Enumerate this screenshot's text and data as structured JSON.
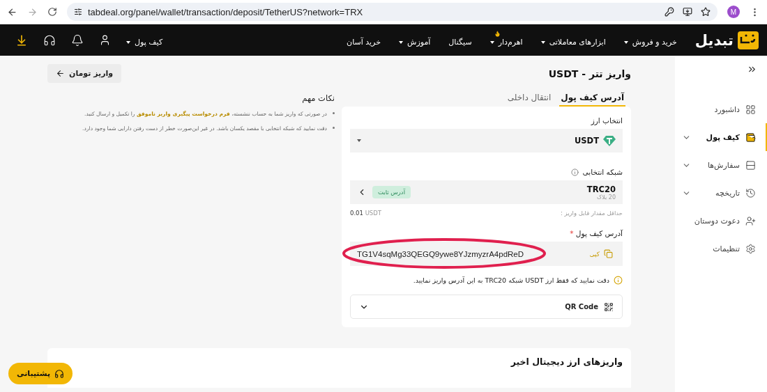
{
  "browser": {
    "url": "tabdeal.org/panel/wallet/transaction/deposit/TetherUS?network=TRX",
    "profile": "M"
  },
  "nav": {
    "logo": "تبدیل",
    "items": [
      {
        "label": "خرید و فروش",
        "dropdown": true,
        "hot": false
      },
      {
        "label": "ابزارهای معاملاتی",
        "dropdown": true,
        "hot": false
      },
      {
        "label": "اهرم‌دار",
        "dropdown": true,
        "hot": true
      },
      {
        "label": "سیگنال",
        "dropdown": false,
        "hot": false
      },
      {
        "label": "آموزش",
        "dropdown": true,
        "hot": false
      },
      {
        "label": "خرید آسان",
        "dropdown": false,
        "hot": false
      }
    ],
    "wallet": "کیف پول"
  },
  "sidebar": {
    "items": [
      {
        "kind": "dashboard",
        "label": "داشبورد",
        "selected": false,
        "expandable": false
      },
      {
        "kind": "wallet",
        "label": "کیف پول",
        "selected": true,
        "expandable": true
      },
      {
        "kind": "orders",
        "label": "سفارش‌ها",
        "selected": false,
        "expandable": true
      },
      {
        "kind": "history",
        "label": "تاریخچه",
        "selected": false,
        "expandable": true
      },
      {
        "kind": "invite",
        "label": "دعوت دوستان",
        "selected": false,
        "expandable": false
      },
      {
        "kind": "settings",
        "label": "تنظیمات",
        "selected": false,
        "expandable": false
      }
    ]
  },
  "page": {
    "title": "واریز تتر - USDT",
    "toman_button": "واریز تومان"
  },
  "tabs": [
    {
      "label": "آدرس کیف پول",
      "selected": true
    },
    {
      "label": "انتقال داخلی",
      "selected": false
    }
  ],
  "form": {
    "currency_label": "انتخاب ارز",
    "currency": "USDT",
    "network_label": "شبکه انتخابی",
    "network": "TRC20",
    "network_blocks": "20 بلاک",
    "network_badge": "آدرس ثابت",
    "min_label": "حداقل مقدار قابل واریز :",
    "min_amount": "0.01",
    "min_unit": "USDT",
    "address_label": "آدرس کیف پول",
    "required_mark": "*",
    "address": "TG1V4sqMg33QEGQ9ywe8YJzmyzrA4pdReD",
    "address_highlighted": true,
    "copy": "کپی",
    "warning": "دقت نمایید که فقط ارز USDT شبکه TRC20 به این آدرس واریز نمایید.",
    "qr": "QR Code",
    "qr_expanded": false
  },
  "notes": {
    "title": "نکات مهم",
    "items": [
      {
        "text": "در صورتی که واریز شما به حساب ننشسته، ",
        "link": "فرم درخواست پیگیری واریز ناموفق",
        "text_after": " را تکمیل و ارسال کنید."
      },
      {
        "text": "دقت نمایید که شبکه انتخابی با مقصد یکسان باشد. در غیر این‌صورت خطر از دست رفتن دارایی شما وجود دارد."
      }
    ]
  },
  "recent": {
    "title": "واریزهای ارز دیجیتال اخیر"
  },
  "support": "پشتیبانی"
}
